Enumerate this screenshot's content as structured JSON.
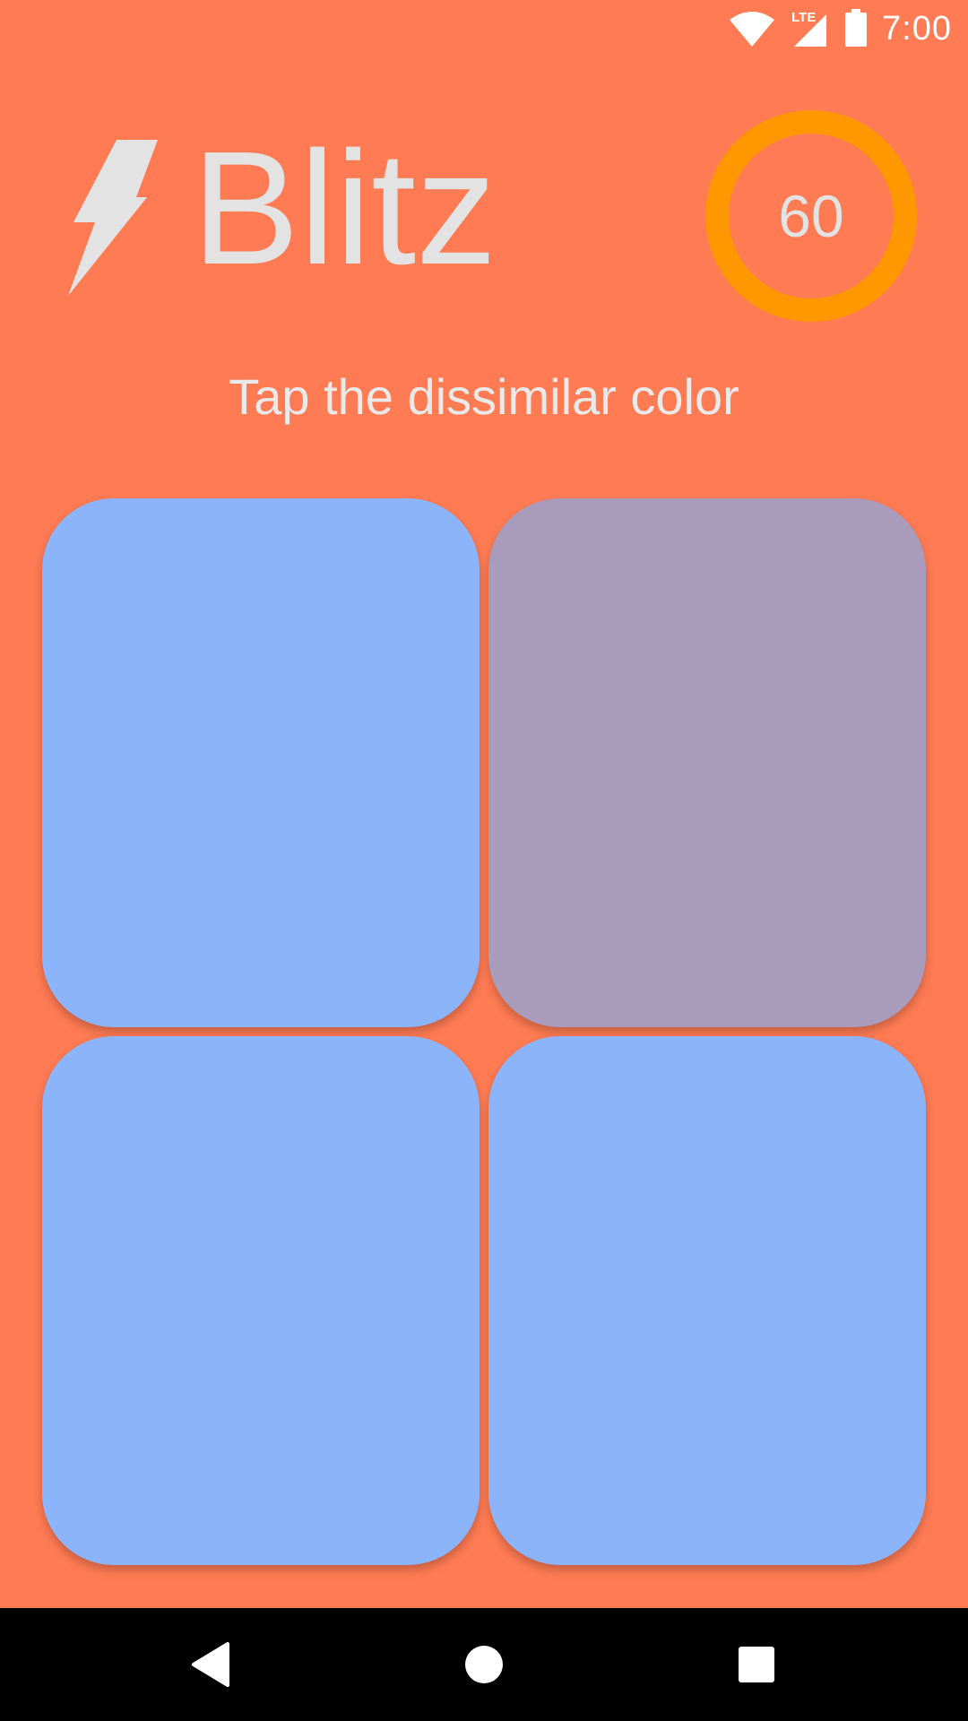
{
  "status_bar": {
    "time": "7:00",
    "network": "LTE",
    "icons": [
      "wifi-icon",
      "lte-signal-icon",
      "battery-icon"
    ]
  },
  "header": {
    "title": "Blitz",
    "logo_icon": "lightning-bolt-icon",
    "timer_value": "60"
  },
  "instruction": "Tap the dissimilar color",
  "tiles": [
    {
      "color": "#8CB4FB"
    },
    {
      "color": "#A99BBB"
    },
    {
      "color": "#8CB4FB"
    },
    {
      "color": "#8CB4FB"
    }
  ],
  "navigation": {
    "buttons": [
      "back-icon",
      "home-icon",
      "recents-icon"
    ]
  },
  "colors": {
    "background": "#FF7B53",
    "timer_ring": "#FF9800",
    "title_text": "#E3E3E3",
    "nav_bar": "#000000"
  }
}
